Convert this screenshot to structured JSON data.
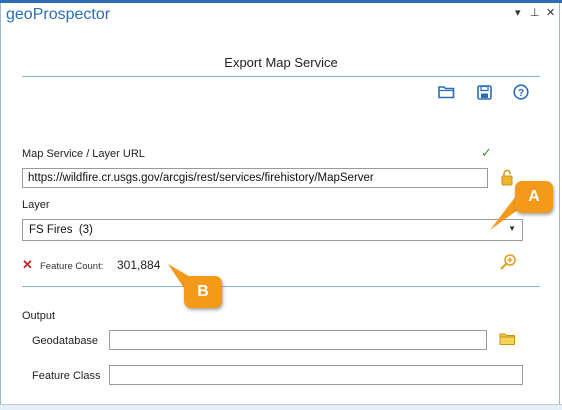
{
  "app": {
    "title": "geoProspector",
    "window_buttons": {
      "menu": "▾",
      "pin": "⊥",
      "close": "✕"
    }
  },
  "panel": {
    "heading": "Export Map Service"
  },
  "toolbar": {
    "icons": [
      "folder-open-icon",
      "save-icon",
      "help-icon"
    ]
  },
  "service": {
    "url_label": "Map Service / Layer URL",
    "url_value": "https://wildfire.cr.usgs.gov/arcgis/rest/services/firehistory/MapServer",
    "valid_mark": "✓"
  },
  "layer": {
    "label": "Layer",
    "selected": "FS Fires  (3)"
  },
  "feature_count": {
    "status_mark": "✕",
    "label": "Feature Count:",
    "value": "301,884"
  },
  "callouts": {
    "a": "A",
    "b": "B"
  },
  "output": {
    "section_label": "Output",
    "geodatabase_label": "Geodatabase",
    "geodatabase_value": "",
    "feature_class_label": "Feature Class",
    "feature_class_value": ""
  },
  "colors": {
    "accent": "#2d6db5",
    "callout": "#f49a1a",
    "valid": "#3a8f3a",
    "error": "#c0282d",
    "folder": "#e8b620"
  }
}
